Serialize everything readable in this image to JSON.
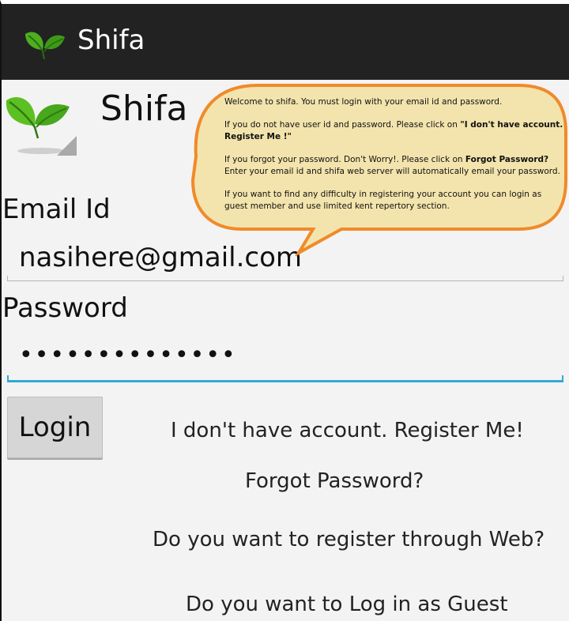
{
  "action_bar": {
    "title": "Shifa",
    "icon": "leaf-icon"
  },
  "header": {
    "title": "Shifa",
    "icon": "leaf-icon"
  },
  "email": {
    "label": "Email Id",
    "value": "nasihere@gmail.com"
  },
  "password": {
    "label": "Password",
    "value": "••••••••••••••"
  },
  "login_button": {
    "label": "Login"
  },
  "links": {
    "register": "I don't have account. Register Me!",
    "forgot": "Forgot Password?",
    "web": "Do you want to register through Web?",
    "guest": "Do you want to Log in as Guest"
  },
  "callout": {
    "line1": "Welcome to shifa. You must login with your email id and password.",
    "line2_pre": "If you do not have user id and password. Please click on ",
    "line2_bold": "\"I don't have account. Register Me !\"",
    "line3_pre": "If you forgot your password. Don't Worry!. Please click on ",
    "line3_bold": "Forgot Password?",
    "line3_post": " Enter your email id and shifa web server will automatically email your password.",
    "line4": "If you want to find any difficulty in registering your account you can login as guest member and use limited kent repertory section."
  },
  "colors": {
    "action_bar": "#222222",
    "focus_line": "#33a8d6",
    "callout_fill": "#f3e4ad",
    "callout_border": "#f08a2a"
  }
}
